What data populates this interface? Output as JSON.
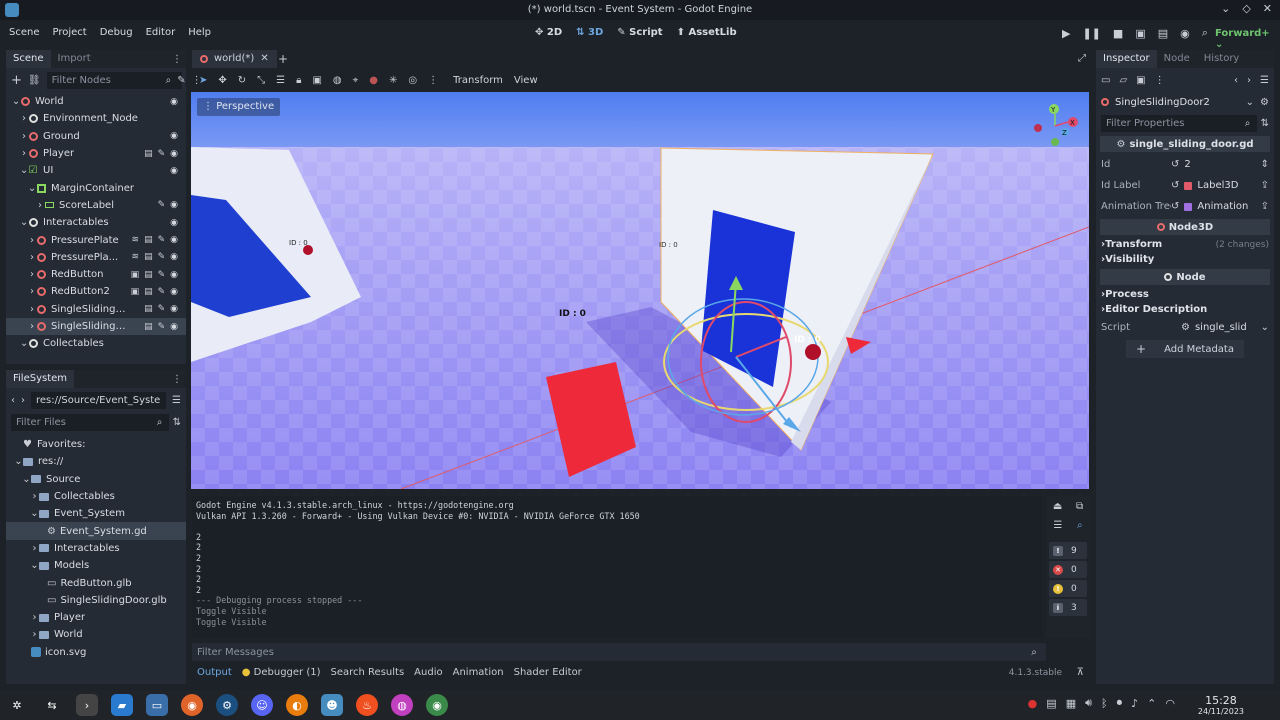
{
  "window": {
    "title": "(*) world.tscn - Event System - Godot Engine"
  },
  "menubar": {
    "menus": [
      "Scene",
      "Project",
      "Debug",
      "Editor",
      "Help"
    ],
    "workspaces": [
      {
        "label": "2D",
        "icon": "2d-icon"
      },
      {
        "label": "3D",
        "icon": "3d-icon"
      },
      {
        "label": "Script",
        "icon": "script-icon"
      },
      {
        "label": "AssetLib",
        "icon": "assetlib-icon"
      }
    ],
    "active_workspace": "3D",
    "renderer": "Forward+"
  },
  "scene_dock": {
    "tabs": [
      "Scene",
      "Import"
    ],
    "filter_placeholder": "Filter Nodes",
    "nodes": [
      {
        "label": "World",
        "depth": 0,
        "icon": "node3d-icon"
      },
      {
        "label": "Environment_Node",
        "depth": 1,
        "icon": "node-icon"
      },
      {
        "label": "Ground",
        "depth": 1,
        "icon": "node3d-icon"
      },
      {
        "label": "Player",
        "depth": 1,
        "icon": "node3d-icon"
      },
      {
        "label": "UI",
        "depth": 1,
        "icon": "control-icon"
      },
      {
        "label": "MarginContainer",
        "depth": 2,
        "icon": "container-icon"
      },
      {
        "label": "ScoreLabel",
        "depth": 3,
        "icon": "label-icon"
      },
      {
        "label": "Interactables",
        "depth": 1,
        "icon": "node-icon"
      },
      {
        "label": "PressurePlate",
        "depth": 2,
        "icon": "node3d-icon"
      },
      {
        "label": "PressurePla...",
        "depth": 2,
        "icon": "node3d-icon"
      },
      {
        "label": "RedButton",
        "depth": 2,
        "icon": "node3d-icon"
      },
      {
        "label": "RedButton2",
        "depth": 2,
        "icon": "node3d-icon"
      },
      {
        "label": "SingleSlidingDoor...",
        "depth": 2,
        "icon": "node3d-icon"
      },
      {
        "label": "SingleSlidingDoo...",
        "depth": 2,
        "icon": "node3d-icon"
      },
      {
        "label": "Collectables",
        "depth": 1,
        "icon": "node-icon"
      }
    ]
  },
  "filesystem": {
    "title": "FileSystem",
    "path": "res://Source/Event_System/",
    "filter_placeholder": "Filter Files",
    "items": [
      {
        "label": "Favorites:",
        "depth": 0
      },
      {
        "label": "res://",
        "depth": 0
      },
      {
        "label": "Source",
        "depth": 1
      },
      {
        "label": "Collectables",
        "depth": 2
      },
      {
        "label": "Event_System",
        "depth": 2
      },
      {
        "label": "Event_System.gd",
        "depth": 3
      },
      {
        "label": "Interactables",
        "depth": 2
      },
      {
        "label": "Models",
        "depth": 2
      },
      {
        "label": "RedButton.glb",
        "depth": 3
      },
      {
        "label": "SingleSlidingDoor.glb",
        "depth": 3
      },
      {
        "label": "Player",
        "depth": 2
      },
      {
        "label": "World",
        "depth": 2
      },
      {
        "label": "icon.svg",
        "depth": 1
      }
    ]
  },
  "editor": {
    "tab_label": "world(*)",
    "toolbar_menus": [
      "Transform",
      "View"
    ],
    "perspective_label": "Perspective",
    "door_labels": [
      "ID : 0",
      "ID : 0",
      "ID : 0"
    ]
  },
  "output": {
    "lines": [
      "Godot Engine v4.1.3.stable.arch_linux - https://godotengine.org",
      "Vulkan API 1.3.260 - Forward+ - Using Vulkan Device #0: NVIDIA - NVIDIA GeForce GTX 1650",
      "",
      "2",
      "2",
      "2",
      "2",
      "2",
      "2",
      "--- Debugging process stopped ---",
      "Toggle Visible",
      "Toggle Visible"
    ],
    "counters": [
      {
        "value": "9",
        "color": "#5a6270",
        "icon": "exclamation-icon"
      },
      {
        "value": "0",
        "color": "#d84a4a",
        "icon": "error-icon"
      },
      {
        "value": "0",
        "color": "#e8c13a",
        "icon": "warning-icon"
      },
      {
        "value": "3",
        "color": "#5a6270",
        "icon": "info-icon"
      }
    ],
    "filter_placeholder": "Filter Messages"
  },
  "bottom_tabs": [
    "Output",
    "Debugger (1)",
    "Search Results",
    "Audio",
    "Animation",
    "Shader Editor"
  ],
  "version": "4.1.3.stable",
  "inspector": {
    "tabs": [
      "Inspector",
      "Node",
      "History"
    ],
    "object": "SingleSlidingDoor2",
    "filter_placeholder": "Filter Properties",
    "script_header": "single_sliding_door.gd",
    "props": [
      {
        "key": "Id",
        "value": "2"
      },
      {
        "key": "Id Label",
        "value": "Label3D"
      },
      {
        "key": "Animation Tree",
        "value": "Animation"
      }
    ],
    "node3d_header": "Node3D",
    "transform": "Transform",
    "transform_note": "(2 changes)",
    "visibility": "Visibility",
    "node_header": "Node",
    "process": "Process",
    "editor_description": "Editor Description",
    "script_key": "Script",
    "script_value": "single_slid",
    "add_metadata": "Add Metadata"
  },
  "taskbar": {
    "time": "15:28",
    "date": "24/11/2023"
  }
}
